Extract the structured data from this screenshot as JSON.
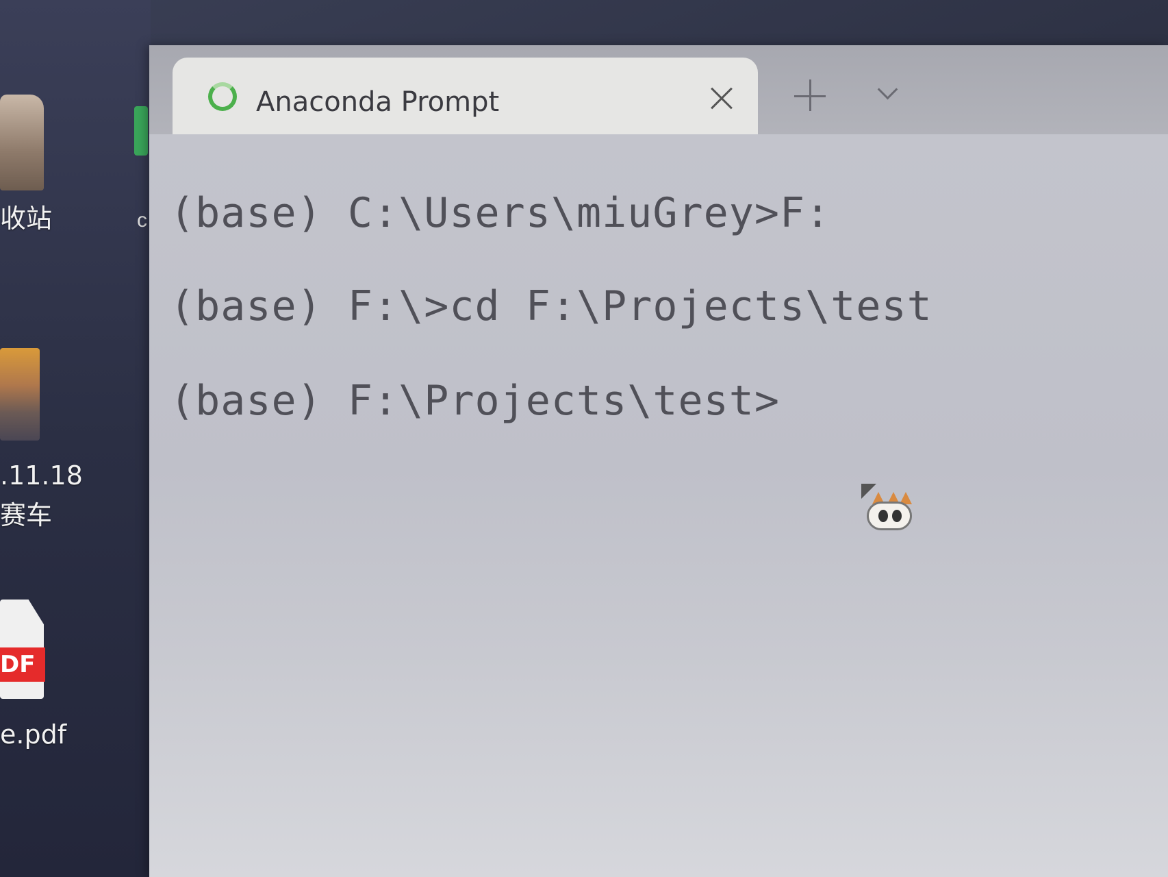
{
  "desktop": {
    "items": [
      {
        "label": "收站",
        "icon": "recycle-bin-icon"
      },
      {
        "label": ".11.18\n赛车",
        "icon": "photo-thumbnail-icon"
      },
      {
        "label": "e.pdf",
        "icon": "pdf-file-icon",
        "badge": "DF"
      }
    ],
    "partial_letter": "c"
  },
  "window": {
    "tab": {
      "title": "Anaconda Prompt",
      "icon": "anaconda-ring-icon",
      "accent": "#4cb04c"
    },
    "controls": {
      "close_icon": "close-icon",
      "new_tab_icon": "plus-icon",
      "dropdown_icon": "chevron-down-icon"
    }
  },
  "terminal": {
    "lines": [
      "(base) C:\\Users\\miuGrey>F:",
      "(base) F:\\>cd F:\\Projects\\test",
      "(base) F:\\Projects\\test>"
    ]
  },
  "cursor": {
    "icon": "cat-cursor-icon"
  }
}
